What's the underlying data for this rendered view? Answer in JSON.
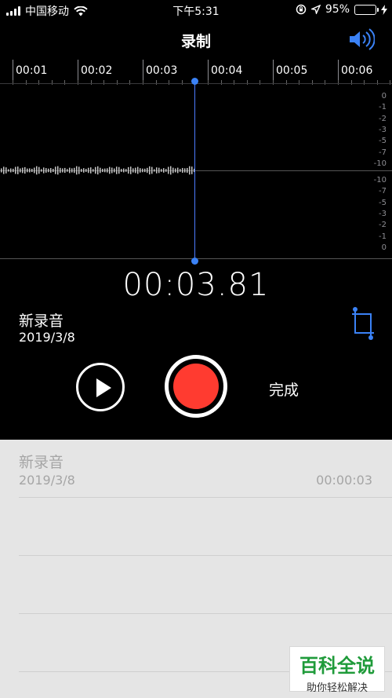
{
  "status": {
    "carrier": "中国移动",
    "time": "下午5:31",
    "battery_pct": "95%",
    "battery_level": 0.95,
    "icons": [
      "signal-icon",
      "wifi-icon",
      "orientation-lock-icon",
      "location-icon",
      "battery-icon",
      "charging-icon"
    ]
  },
  "nav": {
    "title": "录制",
    "speaker_icon": "speaker-icon",
    "accent": "#3b82f6"
  },
  "timeline": {
    "labels": [
      "00:01",
      "00:02",
      "00:03",
      "00:04",
      "00:05",
      "00:06"
    ]
  },
  "db_scale": {
    "upper": [
      "0",
      "-1",
      "-2",
      "-3",
      "-5",
      "-7",
      "-10"
    ],
    "lower": [
      "-10",
      "-7",
      "-5",
      "-3",
      "-2",
      "-1",
      "0"
    ]
  },
  "recorder": {
    "elapsed": "00:03.81",
    "title": "新录音",
    "date": "2019/3/8",
    "done_label": "完成",
    "record_color": "#ff3b30"
  },
  "list": {
    "items": [
      {
        "title": "新录音",
        "date": "2019/3/8",
        "duration": "00:00:03"
      }
    ]
  },
  "watermark": {
    "line1": "百科全说",
    "line2": "助你轻松解决"
  }
}
